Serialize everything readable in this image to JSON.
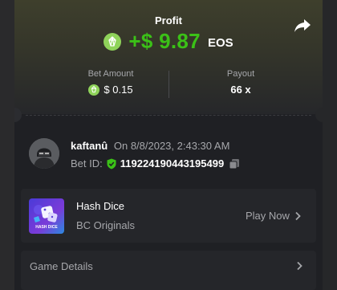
{
  "profit": {
    "label": "Profit",
    "amount": "+$ 9.87",
    "currency": "EOS",
    "coin_icon": "eos-coin-icon",
    "share_icon": "share-arrow-icon"
  },
  "stats": {
    "bet_amount_label": "Bet Amount",
    "bet_amount_value": "$ 0.15",
    "payout_label": "Payout",
    "payout_value": "66 x"
  },
  "bet": {
    "username": "kaftanû",
    "time": "On 8/8/2023, 2:43:30 AM",
    "bet_id_label": "Bet ID:",
    "bet_id_value": "119224190443195499",
    "verified_icon": "shield-check-icon",
    "copy_icon": "copy-icon"
  },
  "game": {
    "name": "Hash Dice",
    "provider": "BC Originals",
    "thumb_text": "HASH DICE",
    "play_label": "Play Now"
  },
  "details": {
    "label": "Game Details"
  },
  "colors": {
    "profit_green": "#3bc117",
    "coin_green": "#8fd35a",
    "card_bg": "#1f2024",
    "muted_text": "#a6a7ab"
  }
}
